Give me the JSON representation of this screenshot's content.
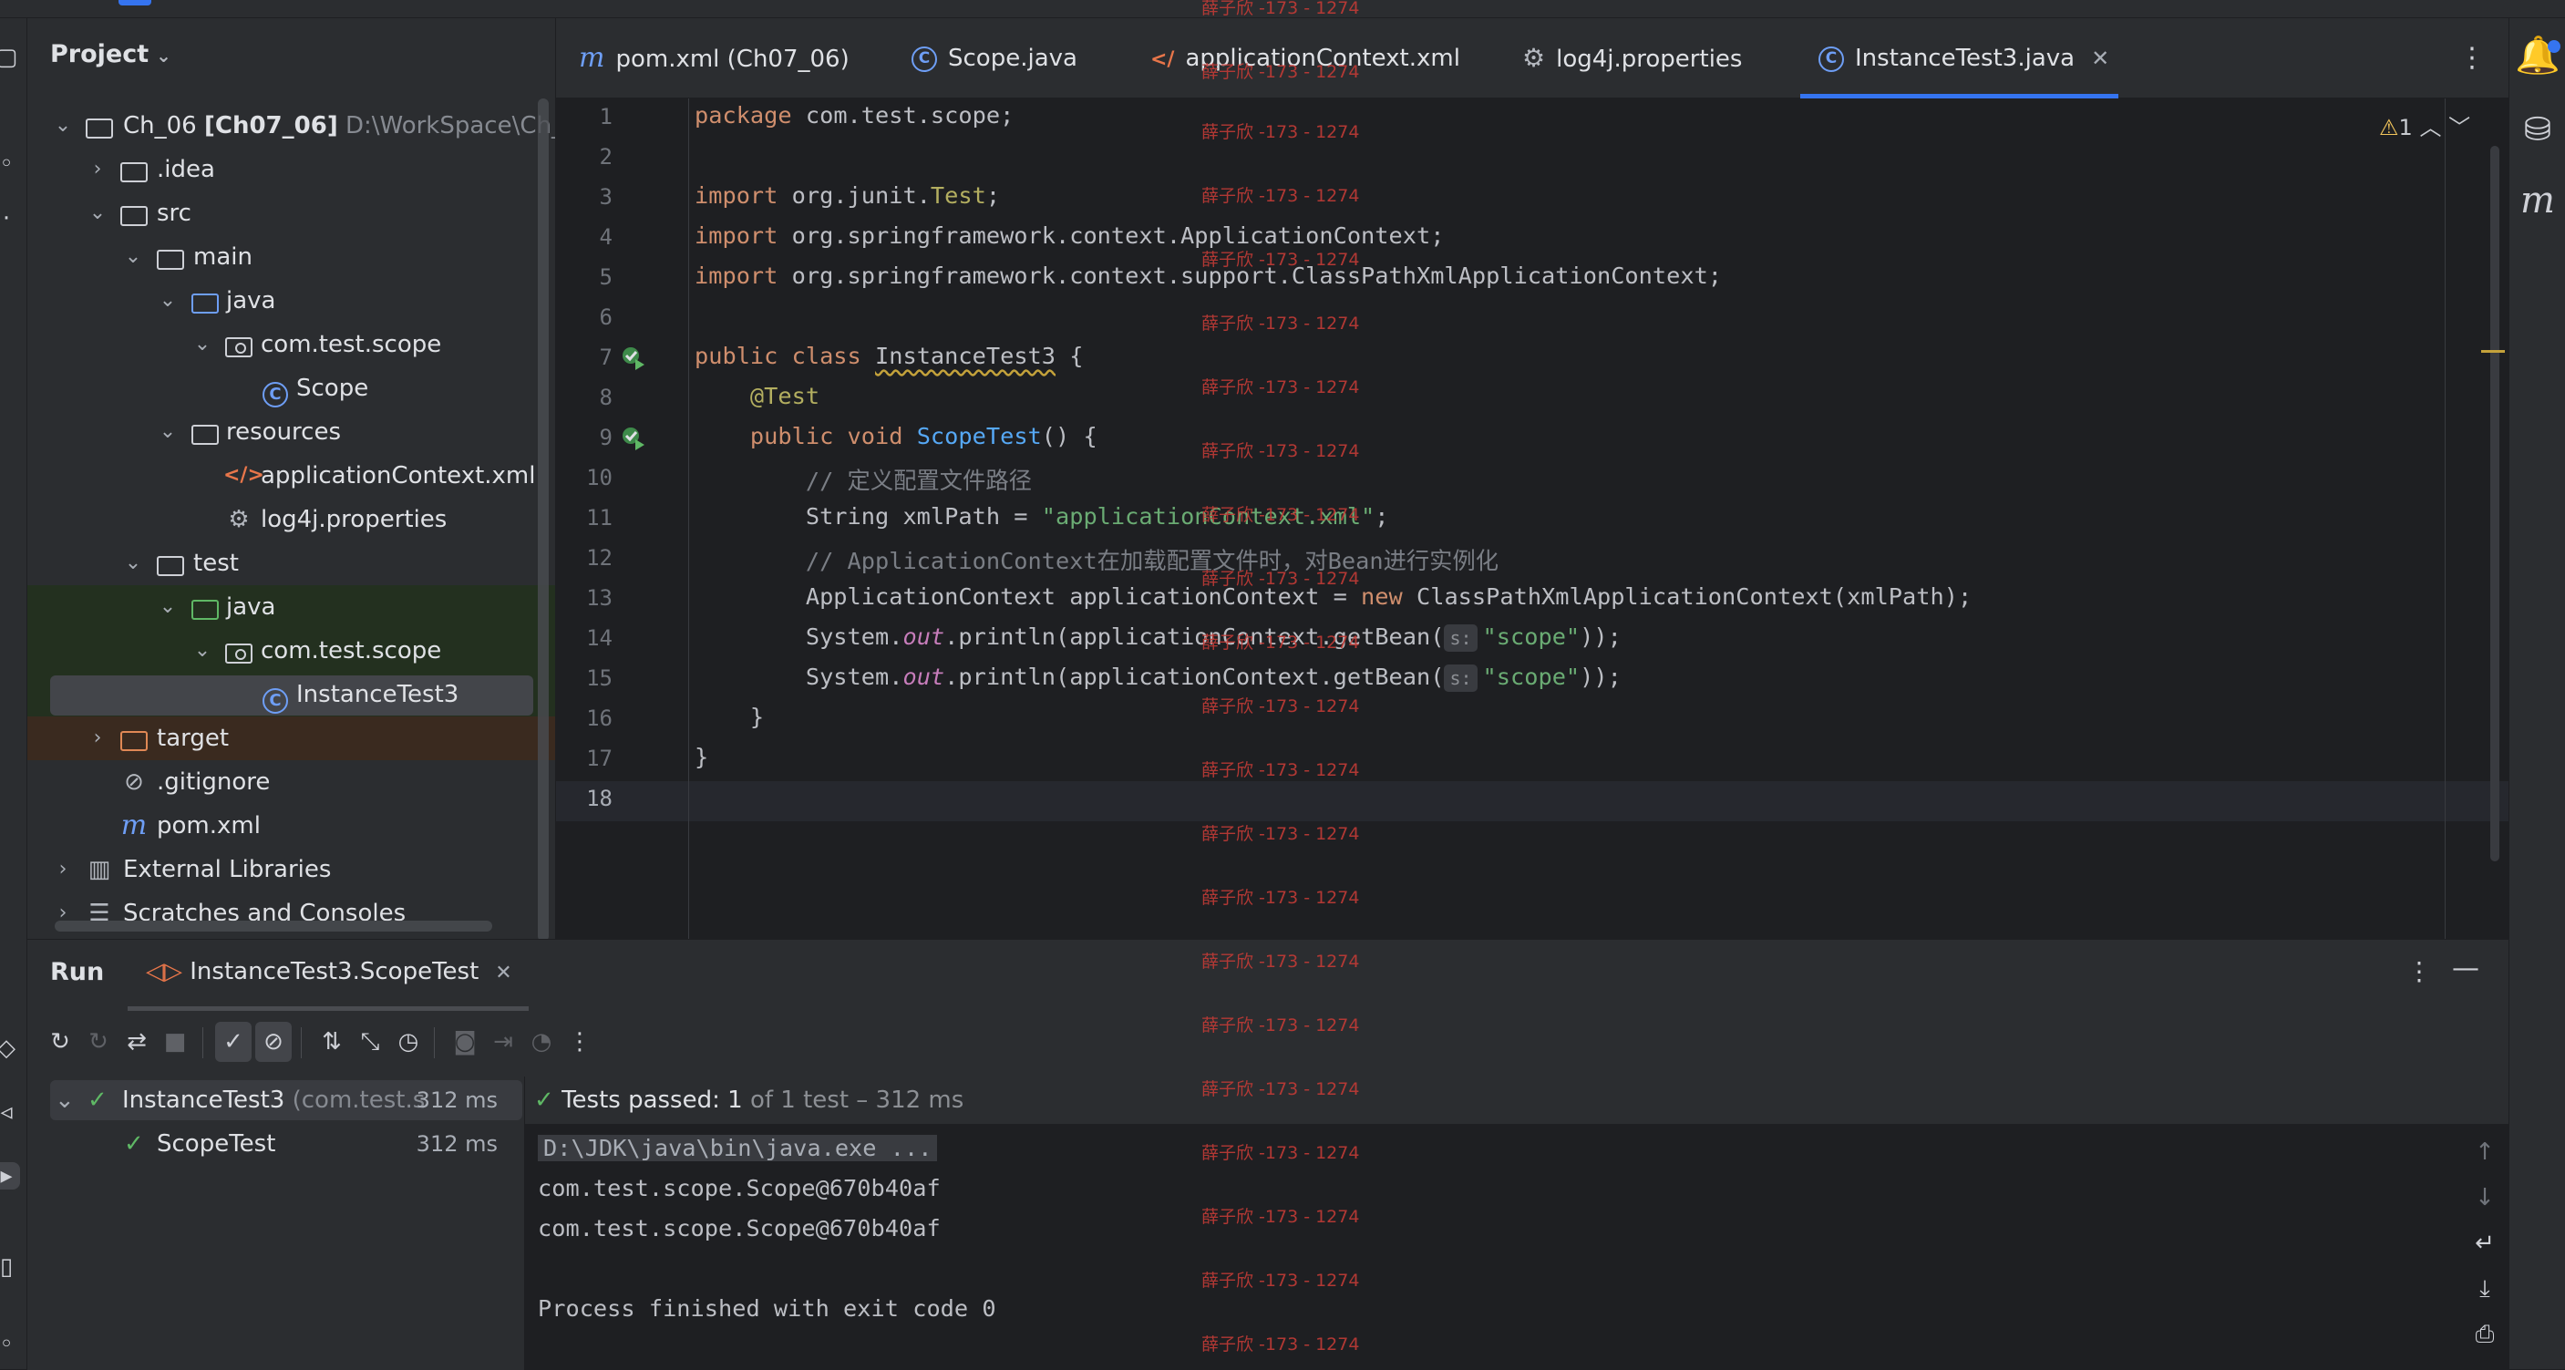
{
  "project_panel": {
    "title": "Project",
    "tree": [
      {
        "label": "Ch_06",
        "module": "[Ch07_06]",
        "path": "D:\\WorkSpace\\Ch_0"
      },
      {
        "label": ".idea"
      },
      {
        "label": "src"
      },
      {
        "label": "main"
      },
      {
        "label": "java"
      },
      {
        "label": "com.test.scope"
      },
      {
        "label": "Scope"
      },
      {
        "label": "resources"
      },
      {
        "label": "applicationContext.xml"
      },
      {
        "label": "log4j.properties"
      },
      {
        "label": "test"
      },
      {
        "label": "java"
      },
      {
        "label": "com.test.scope"
      },
      {
        "label": "InstanceTest3"
      },
      {
        "label": "target"
      },
      {
        "label": ".gitignore"
      },
      {
        "label": "pom.xml"
      },
      {
        "label": "External Libraries"
      },
      {
        "label": "Scratches and Consoles"
      }
    ]
  },
  "tabs": [
    {
      "label": "pom.xml (Ch07_06)",
      "icon": "maven-icon"
    },
    {
      "label": "Scope.java",
      "icon": "class-icon"
    },
    {
      "label": "applicationContext.xml",
      "icon": "xml-icon"
    },
    {
      "label": "log4j.properties",
      "icon": "gear-icon"
    },
    {
      "label": "InstanceTest3.java",
      "icon": "class-icon",
      "active": true
    }
  ],
  "editor": {
    "warning_count": "1",
    "line_numbers": [
      "1",
      "2",
      "3",
      "4",
      "5",
      "6",
      "7",
      "8",
      "9",
      "10",
      "11",
      "12",
      "13",
      "14",
      "15",
      "16",
      "17",
      "18"
    ],
    "code": {
      "l1_kw": "package",
      "l1_rest": " com.test.scope;",
      "l3_kw": "import",
      "l3_a": " org.junit.",
      "l3_b": "Test",
      "l3_c": ";",
      "l4_kw": "import",
      "l4_rest": " org.springframework.context.ApplicationContext;",
      "l5_kw": "import",
      "l5_rest": " org.springframework.context.support.ClassPathXmlApplicationContext;",
      "l7_kw1": "public",
      "l7_kw2": " class ",
      "l7_name": "InstanceTest3",
      "l7_rest": " {",
      "l8_ann": "@Test",
      "l9_kw1": "public",
      "l9_kw2": " void ",
      "l9_fn": "ScopeTest",
      "l9_rest": "() {",
      "l10_cm": "// 定义配置文件路径",
      "l11_a": "String xmlPath = ",
      "l11_st": "\"applicationContext.xml\"",
      "l11_b": ";",
      "l12_cm": "// ApplicationContext在加载配置文件时，对Bean进行实例化",
      "l13_a": "ApplicationContext applicationContext = ",
      "l13_kw": "new",
      "l13_b": " ClassPathXmlApplicationContext(xmlPath);",
      "l14_a": "System.",
      "l14_it": "out",
      "l14_b": ".println(applicationContext.getBean(",
      "l14_hint": "s:",
      "l14_st": "\"scope\"",
      "l14_c": "));",
      "l15_a": "System.",
      "l15_it": "out",
      "l15_b": ".println(applicationContext.getBean(",
      "l15_hint": "s:",
      "l15_st": "\"scope\"",
      "l15_c": "));",
      "l16": "}",
      "l17": "}"
    }
  },
  "run_panel": {
    "title": "Run",
    "tab_label": "InstanceTest3.ScopeTest",
    "results": [
      {
        "name": "InstanceTest3",
        "detail": "(com.test.s",
        "time": "312 ms"
      },
      {
        "name": "ScopeTest",
        "time": "312 ms"
      }
    ],
    "status_main": "Tests passed:",
    "status_count": "1",
    "status_detail": "of 1 test – 312 ms",
    "console": [
      "D:\\JDK\\java\\bin\\java.exe ...",
      "com.test.scope.Scope@670b40af",
      "com.test.scope.Scope@670b40af",
      "",
      "Process finished with exit code 0"
    ]
  },
  "watermark": "薛子欣 -173 - 1274",
  "colors": {
    "accent": "#3574f0",
    "editor_bg": "#1e1f22",
    "panel_bg": "#2b2d30",
    "keyword": "#cf8e6d",
    "string": "#6aab73",
    "function": "#56a8f5",
    "annotation": "#b3ae60",
    "success": "#5fb865"
  }
}
